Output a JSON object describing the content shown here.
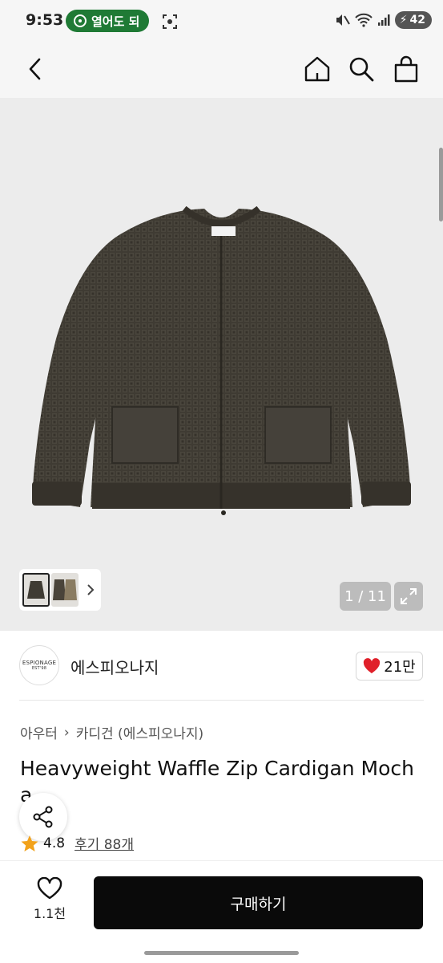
{
  "status_bar": {
    "time": "9:53",
    "notification_pill": "열어도 되",
    "battery": "42"
  },
  "gallery": {
    "counter": "1 / 11",
    "thumbnail_count": 2
  },
  "seller": {
    "logo_text": "ESPIONAGE",
    "logo_subtext": "EST'98",
    "name": "에스피오나지",
    "like_count": "21만"
  },
  "product": {
    "breadcrumb": [
      "아우터",
      "카디건 (에스피오나지)"
    ],
    "title_line1": "Heavyweight Waffle Zip Cardigan Moch",
    "title_line2": "a",
    "rating": "4.8",
    "reviews": "후기 88개"
  },
  "bottom_bar": {
    "wish_count": "1.1천",
    "buy_label": "구매하기"
  },
  "colors": {
    "pill_green": "#1f7a35",
    "heart_red": "#e0202a",
    "star_orange": "#f2a21b",
    "buy_button": "#0a0a0a",
    "sweater": "#3f3b33"
  }
}
